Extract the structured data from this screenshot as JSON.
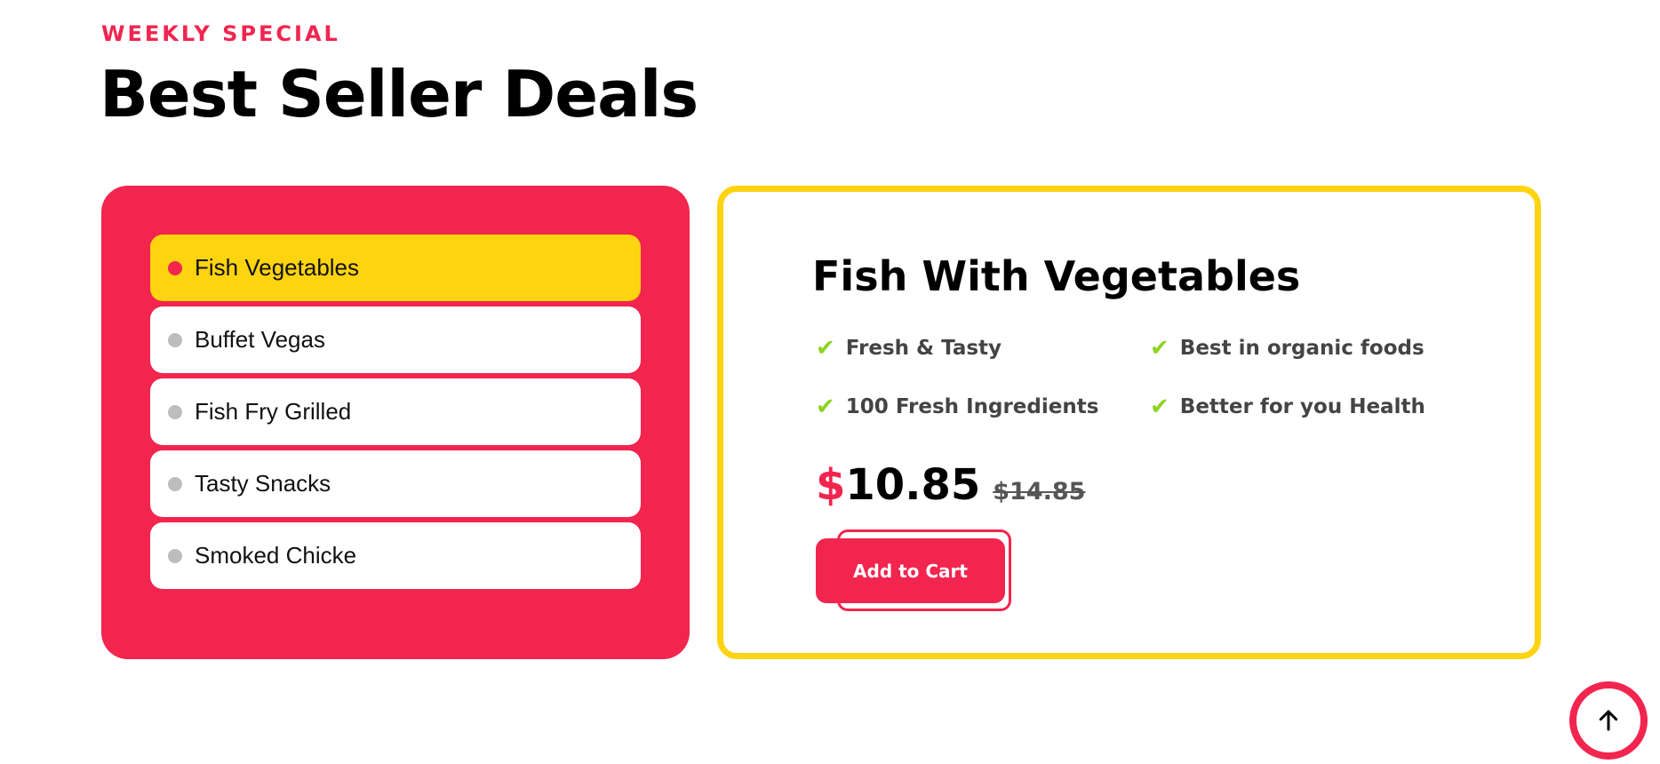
{
  "section": {
    "subheading": "WEEKLY SPECIAL",
    "title": "Best Seller Deals"
  },
  "menu": {
    "items": [
      {
        "label": "Fish Vegetables",
        "active": true
      },
      {
        "label": "Buffet Vegas",
        "active": false
      },
      {
        "label": "Fish Fry Grilled",
        "active": false
      },
      {
        "label": "Tasty Snacks",
        "active": false
      },
      {
        "label": "Smoked Chicke",
        "active": false
      }
    ]
  },
  "product": {
    "title": "Fish With Vegetables",
    "features": [
      "Fresh & Tasty",
      "Best in organic foods",
      "100 Fresh Ingredients",
      "Better for you Health"
    ],
    "currency": "$",
    "price": "10.85",
    "old_price": "$14.85",
    "cart_label": "Add to Cart"
  },
  "icons": {
    "feature_check": "check-icon",
    "scroll_top": "arrow-up-icon"
  },
  "colors": {
    "accent_red": "#f2254f",
    "accent_yellow": "#fed310",
    "check_green": "#8cd422"
  }
}
